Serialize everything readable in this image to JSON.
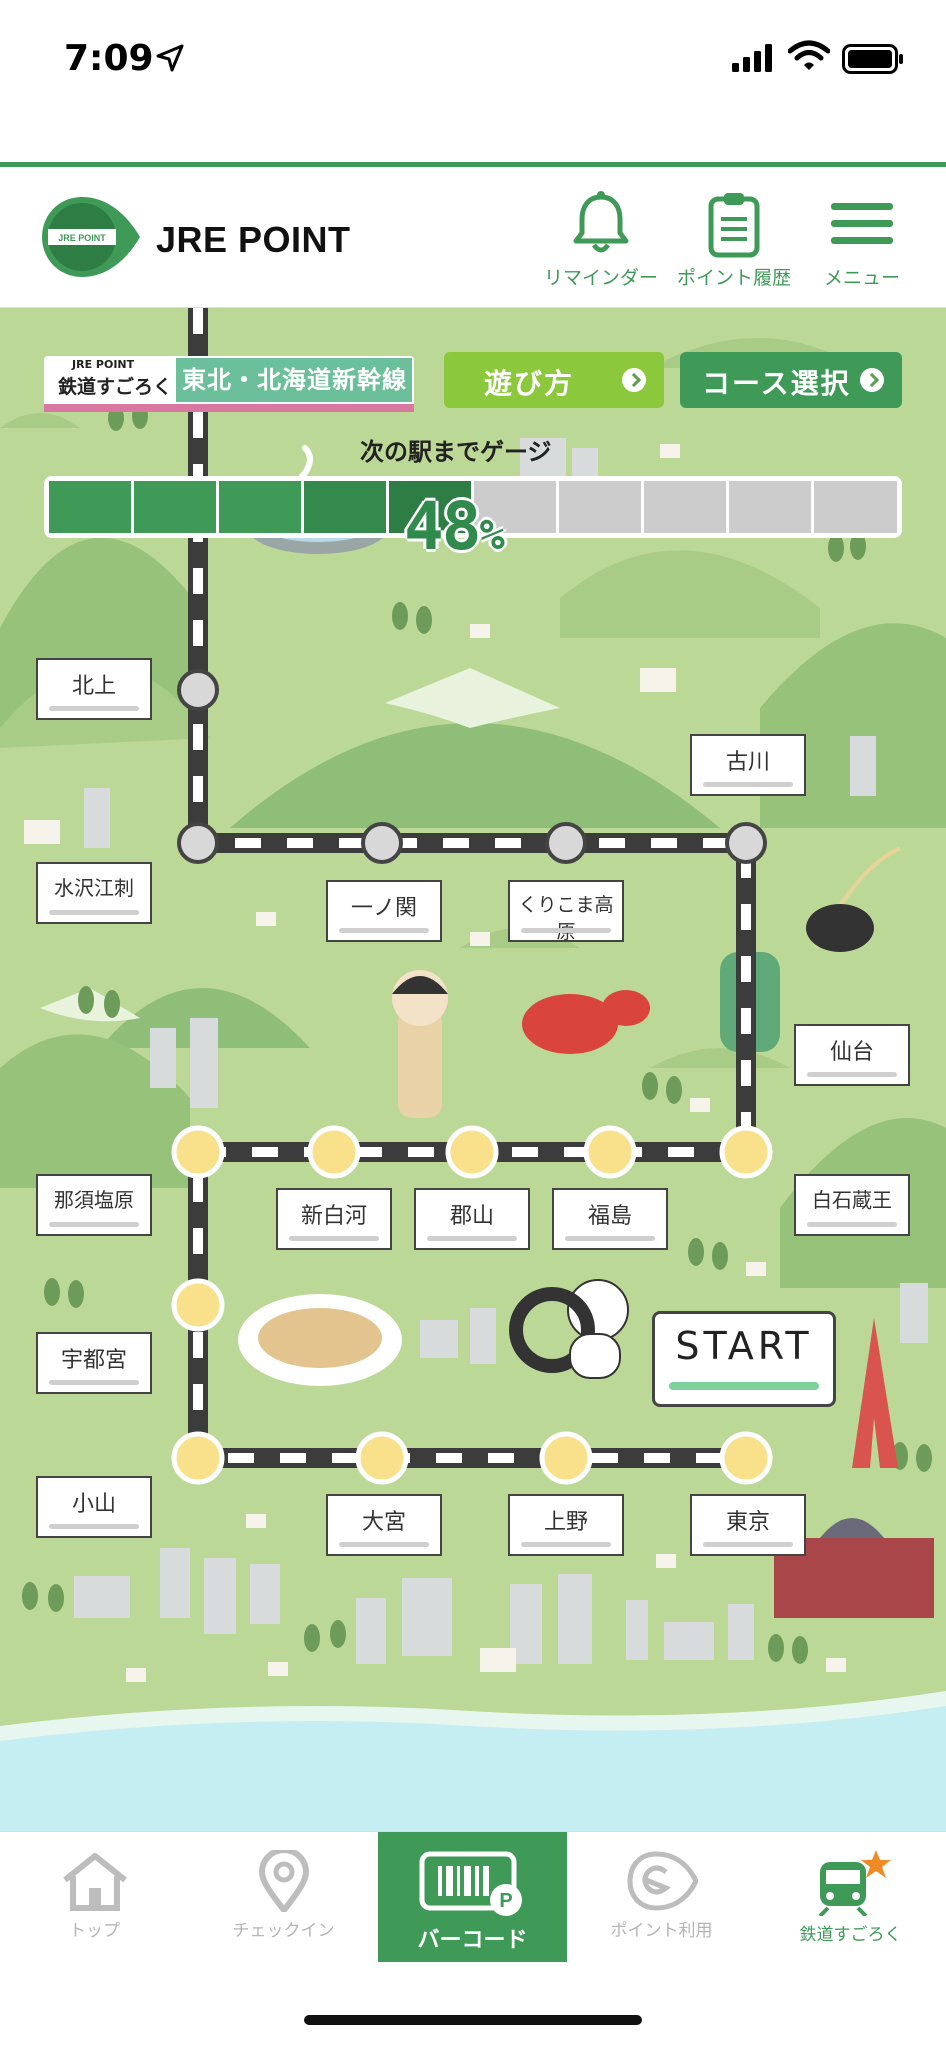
{
  "status_bar": {
    "time": "7:09"
  },
  "header": {
    "app_name": "JRE POINT",
    "logo_badge": "JRE POINT",
    "buttons": [
      {
        "label": "リマインダー",
        "icon": "bell-icon"
      },
      {
        "label": "ポイント履歴",
        "icon": "clipboard-icon"
      },
      {
        "label": "メニュー",
        "icon": "hamburger-menu-icon"
      }
    ],
    "accent_color": "#3f9a58"
  },
  "game": {
    "brand_small": "JRE POINT",
    "title": "鉄道すごろく",
    "route": "東北・北海道新幹線",
    "how_to_play": "遊び方",
    "course_select": "コース選択",
    "gauge_label": "次の駅までゲージ",
    "gauge_percent": 48,
    "gauge_percent_text": "48",
    "gauge_unit": "%",
    "start_label": "START"
  },
  "stations": [
    {
      "id": "kitakami",
      "name": "北上",
      "reached": false
    },
    {
      "id": "furukawa",
      "name": "古川",
      "reached": false
    },
    {
      "id": "mizusawaesashi",
      "name": "水沢江刺",
      "reached": false
    },
    {
      "id": "ichinoseki",
      "name": "一ノ関",
      "reached": false
    },
    {
      "id": "kurikomakogen",
      "name": "くりこま高原",
      "reached": false
    },
    {
      "id": "sendai",
      "name": "仙台",
      "reached": false
    },
    {
      "id": "nasushiobara",
      "name": "那須塩原",
      "reached": true
    },
    {
      "id": "shinshirakawa",
      "name": "新白河",
      "reached": true
    },
    {
      "id": "koriyama",
      "name": "郡山",
      "reached": true
    },
    {
      "id": "fukushima",
      "name": "福島",
      "reached": true
    },
    {
      "id": "shiroishizao",
      "name": "白石蔵王",
      "reached": true
    },
    {
      "id": "utsunomiya",
      "name": "宇都宮",
      "reached": true
    },
    {
      "id": "oyama",
      "name": "小山",
      "reached": true
    },
    {
      "id": "omiya",
      "name": "大宮",
      "reached": true
    },
    {
      "id": "ueno",
      "name": "上野",
      "reached": true
    },
    {
      "id": "tokyo",
      "name": "東京",
      "reached": true
    }
  ],
  "bottom_nav": [
    {
      "label": "トップ",
      "icon": "home-icon",
      "active": false
    },
    {
      "label": "チェックイン",
      "icon": "location-pin-icon",
      "active": false
    },
    {
      "label": "バーコード",
      "icon": "barcode-icon",
      "active": true
    },
    {
      "label": "ポイント利用",
      "icon": "point-use-icon",
      "active": false
    },
    {
      "label": "鉄道すごろく",
      "icon": "train-star-icon",
      "active": false
    }
  ]
}
